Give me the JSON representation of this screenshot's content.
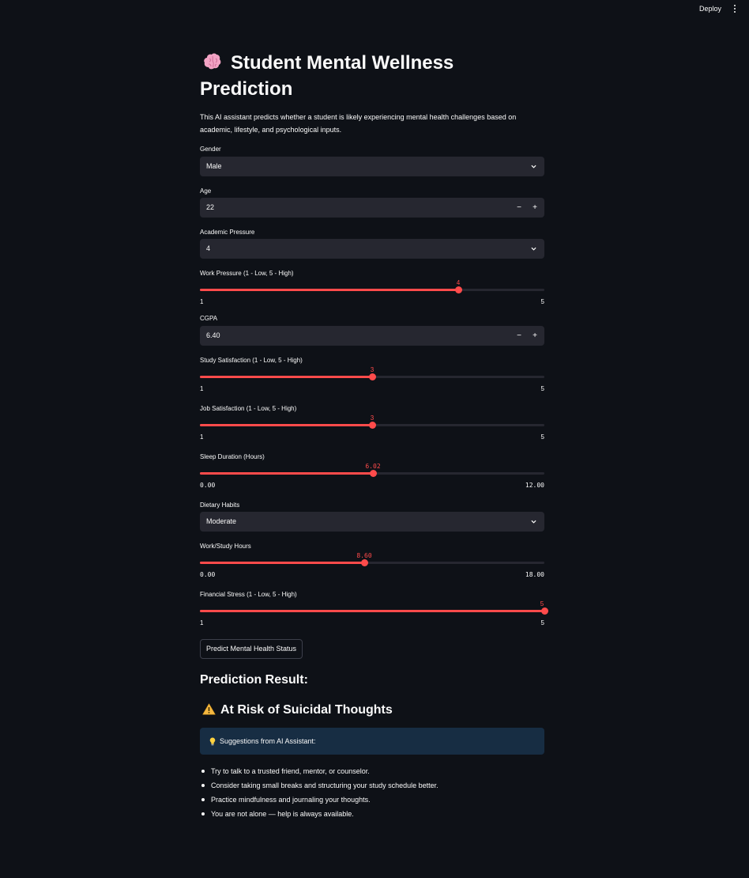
{
  "header": {
    "deploy_label": "Deploy",
    "menu_icon": "kebab-menu-icon"
  },
  "title": {
    "icon": "brain-icon",
    "line1": "Student Mental Wellness",
    "line2": "Prediction"
  },
  "description": "This AI assistant predicts whether a student is likely experiencing mental health challenges based on academic, lifestyle, and psychological inputs.",
  "fields": {
    "gender": {
      "label": "Gender",
      "value": "Male"
    },
    "age": {
      "label": "Age",
      "value": "22",
      "minus": "−",
      "plus": "+"
    },
    "academic_pressure": {
      "label": "Academic Pressure",
      "value": "4"
    },
    "work_pressure": {
      "label": "Work Pressure (1 - Low, 5 - High)",
      "value": "4",
      "min": "1",
      "max": "5",
      "fraction": 0.75
    },
    "cgpa": {
      "label": "CGPA",
      "value": "6.40",
      "minus": "−",
      "plus": "+"
    },
    "study_satisfaction": {
      "label": "Study Satisfaction (1 - Low, 5 - High)",
      "value": "3",
      "min": "1",
      "max": "5",
      "fraction": 0.5
    },
    "job_satisfaction": {
      "label": "Job Satisfaction (1 - Low, 5 - High)",
      "value": "3",
      "min": "1",
      "max": "5",
      "fraction": 0.5
    },
    "sleep_duration": {
      "label": "Sleep Duration (Hours)",
      "value": "6.02",
      "min": "0.00",
      "max": "12.00",
      "fraction": 0.5017
    },
    "dietary_habits": {
      "label": "Dietary Habits",
      "value": "Moderate"
    },
    "work_study_hours": {
      "label": "Work/Study Hours",
      "value": "8.60",
      "min": "0.00",
      "max": "18.00",
      "fraction": 0.4778
    },
    "financial_stress": {
      "label": "Financial Stress (1 - Low, 5 - High)",
      "value": "5",
      "min": "1",
      "max": "5",
      "fraction": 1.0
    }
  },
  "predict_button": "Predict Mental Health Status",
  "result": {
    "heading": "Prediction Result:",
    "status_icon": "warning-icon",
    "status": "At Risk of Suicidal Thoughts",
    "info_icon": "lightbulb-icon",
    "info_text": "Suggestions from AI Assistant:",
    "suggestions": [
      "Try to talk to a trusted friend, mentor, or counselor.",
      "Consider taking small breaks and structuring your study schedule better.",
      "Practice mindfulness and journaling your thoughts.",
      "You are not alone — help is always available."
    ]
  },
  "colors": {
    "background": "#0e1117",
    "widget": "#262730",
    "accent": "#ff4b4b",
    "info_bg": "#172d43"
  }
}
